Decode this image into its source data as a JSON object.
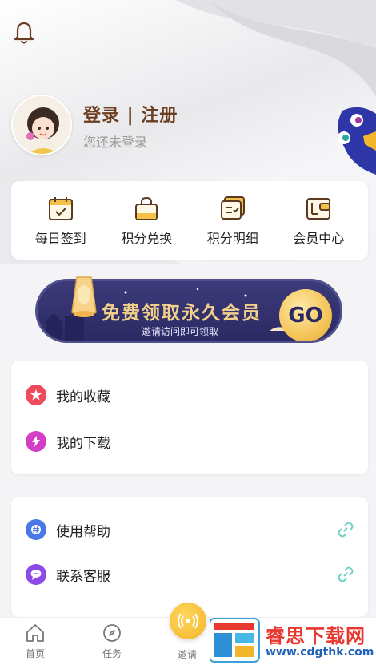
{
  "header": {
    "login_title": "登录 | 注册",
    "login_subtitle": "您还未登录"
  },
  "quick_actions": [
    {
      "label": "每日签到",
      "icon": "calendar-check-icon"
    },
    {
      "label": "积分兑换",
      "icon": "shopping-bag-icon"
    },
    {
      "label": "积分明细",
      "icon": "list-card-icon"
    },
    {
      "label": "会员中心",
      "icon": "wallet-icon"
    }
  ],
  "banner": {
    "title": "免费领取永久会员",
    "subtitle": "邀请访问即可领取",
    "button": "GO"
  },
  "menu_primary": [
    {
      "label": "我的收藏",
      "icon": "star-icon",
      "color": "#f04a5c"
    },
    {
      "label": "我的下载",
      "icon": "lightning-icon",
      "color": "#d33fc4"
    }
  ],
  "menu_secondary": [
    {
      "label": "使用帮助",
      "icon": "hash-icon",
      "color": "#4a78e8"
    },
    {
      "label": "联系客服",
      "icon": "chat-icon",
      "color": "#8b4ae8"
    }
  ],
  "tabbar": {
    "tabs": [
      "首页",
      "任务"
    ],
    "invite_label": "邀请"
  },
  "watermark": {
    "text": "睿思下载网",
    "url": "www.cdgthk.com"
  },
  "colors": {
    "brand_brown": "#6b3d21",
    "banner_navy": "#2b2a63",
    "gold": "#f3d08a",
    "link_teal": "#6fd3c7"
  }
}
